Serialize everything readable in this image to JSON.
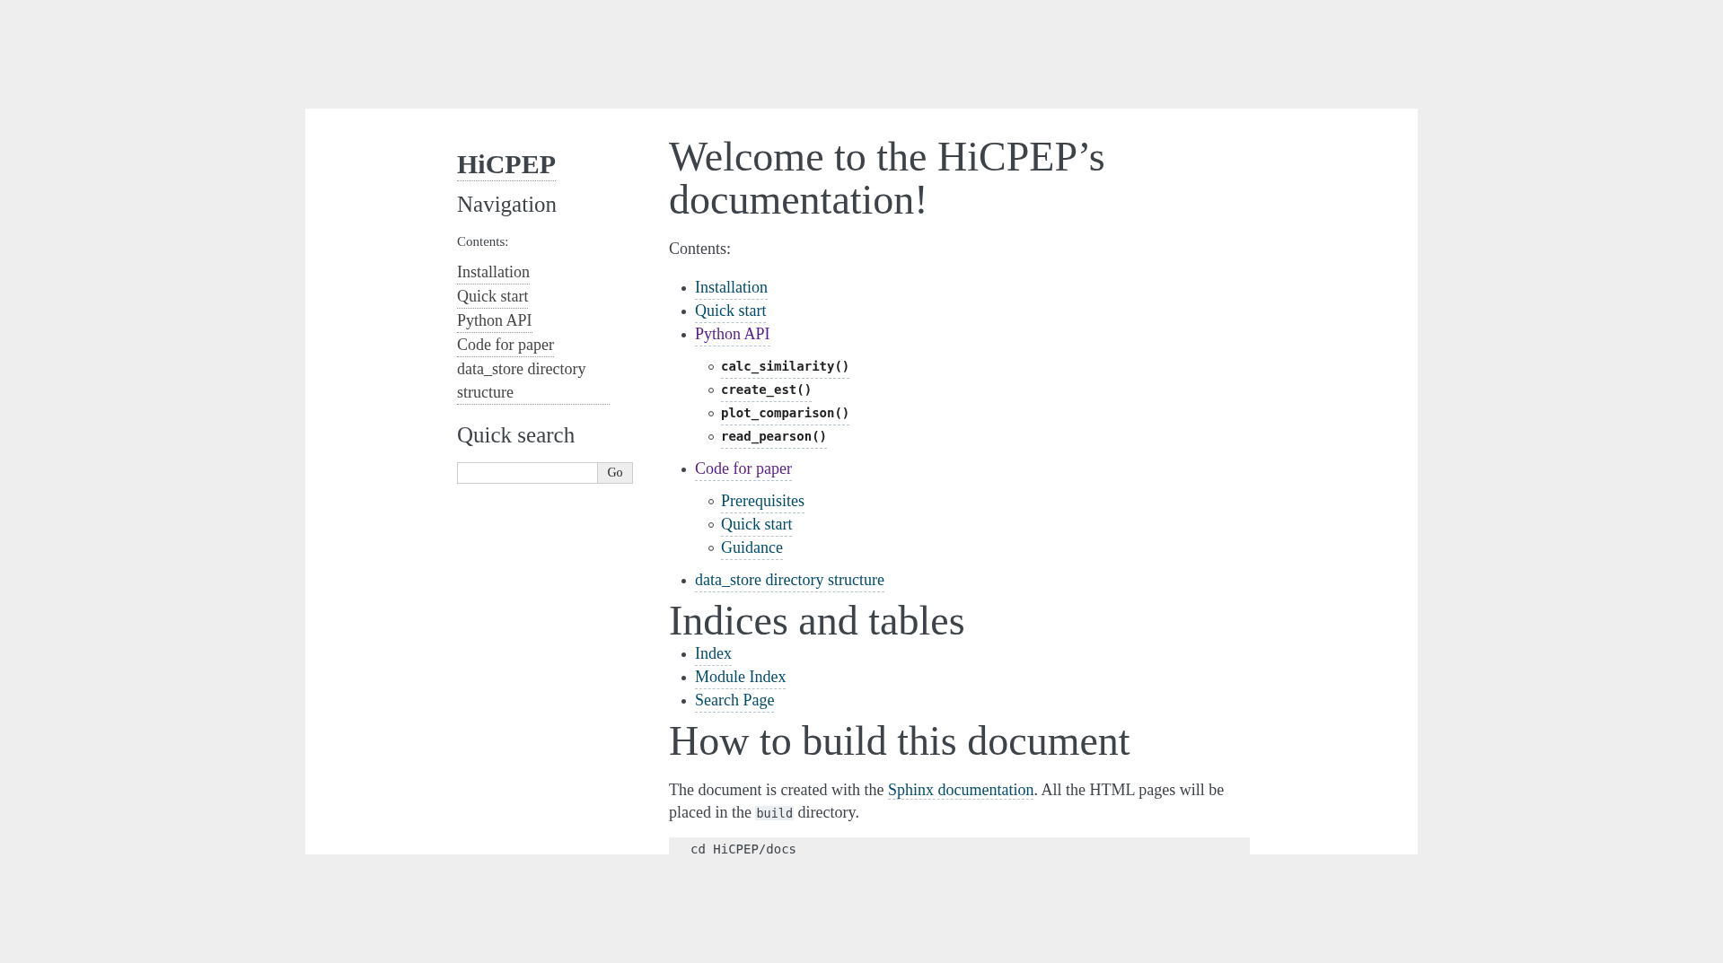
{
  "sidebar": {
    "logo": "HiCPEP",
    "navigation_heading": "Navigation",
    "caption": "Contents:",
    "links": [
      {
        "label": "Installation"
      },
      {
        "label": "Quick start"
      },
      {
        "label": "Python API"
      },
      {
        "label": "Code for paper"
      },
      {
        "label": "data_store directory structure"
      }
    ],
    "search_heading": "Quick search",
    "search_button": "Go"
  },
  "main": {
    "sections": [
      {
        "heading": "Welcome to the HiCPEP’s documentation!",
        "caption": "Contents:",
        "items": [
          {
            "label": "Installation",
            "kind": "text",
            "visited": false
          },
          {
            "label": "Quick start",
            "kind": "text",
            "visited": false
          },
          {
            "label": "Python API",
            "kind": "text",
            "visited": true,
            "children": [
              {
                "label": "calc_similarity()",
                "kind": "code"
              },
              {
                "label": "create_est()",
                "kind": "code"
              },
              {
                "label": "plot_comparison()",
                "kind": "code"
              },
              {
                "label": "read_pearson()",
                "kind": "code"
              }
            ]
          },
          {
            "label": "Code for paper",
            "kind": "text",
            "visited": true,
            "children": [
              {
                "label": "Prerequisites",
                "kind": "text",
                "visited": false
              },
              {
                "label": "Quick start",
                "kind": "text",
                "visited": false
              },
              {
                "label": "Guidance",
                "kind": "text",
                "visited": false
              }
            ]
          },
          {
            "label": "data_store directory structure",
            "kind": "text",
            "visited": false
          }
        ]
      },
      {
        "heading": "Indices and tables",
        "items": [
          {
            "label": "Index",
            "kind": "text",
            "visited": false
          },
          {
            "label": "Module Index",
            "kind": "text",
            "visited": false
          },
          {
            "label": "Search Page",
            "kind": "text",
            "visited": false
          }
        ]
      },
      {
        "heading": "How to build this document",
        "paragraph": [
          {
            "kind": "text",
            "text": "The document is created with the "
          },
          {
            "kind": "link",
            "text": "Sphinx documentation"
          },
          {
            "kind": "text",
            "text": ". All the HTML pages will be placed in the "
          },
          {
            "kind": "code",
            "text": "build"
          },
          {
            "kind": "text",
            "text": " directory."
          }
        ],
        "code_block": "cd HiCPEP/docs"
      }
    ]
  }
}
